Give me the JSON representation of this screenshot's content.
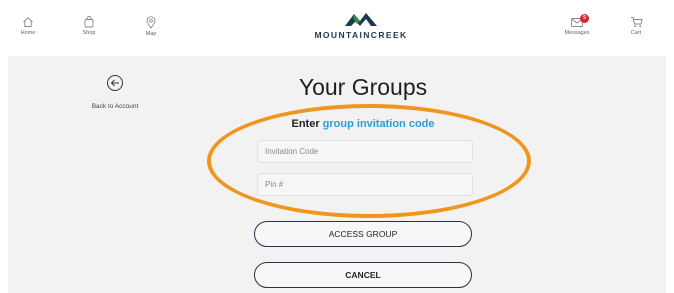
{
  "nav": {
    "home_label": "Home",
    "shop_label": "Shop",
    "map_label": "Map",
    "messages_label": "Messages",
    "messages_badge": "5",
    "cart_label": "Cart"
  },
  "brand": {
    "name": "MOUNTAINCREEK",
    "color_dark": "#1d3a4d",
    "color_green": "#2a8a4a"
  },
  "back": {
    "label": "Back to Account"
  },
  "page": {
    "title": "Your Groups",
    "enter_prefix": "Enter",
    "enter_link": "group invitation code"
  },
  "form": {
    "invitation_placeholder": "Invitation Code",
    "invitation_value": "",
    "pin_placeholder": "Pin #",
    "pin_value": "",
    "access_label": "ACCESS GROUP",
    "cancel_label": "CANCEL"
  },
  "colors": {
    "highlight_oval": "#f0951d",
    "link": "#2a9fd6",
    "badge": "#d8262f",
    "button_border": "#2c2f4e"
  }
}
